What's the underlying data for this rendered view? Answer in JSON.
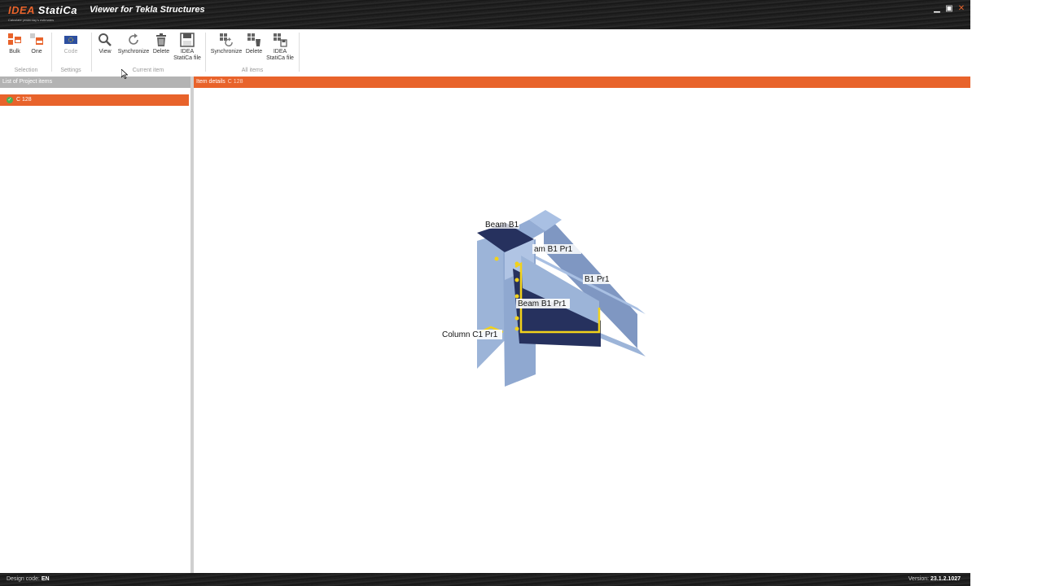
{
  "titlebar": {
    "logo_idea": "IDEA",
    "logo_statica": "StatiCa",
    "logo_tagline": "Calculate yesterday's estimates",
    "app_title": "Viewer for Tekla Structures",
    "minimize": "▁",
    "maximize": "▣",
    "close": "✕"
  },
  "ribbon": {
    "selection": {
      "bulk": "Bulk",
      "one": "One",
      "group": "Selection"
    },
    "settings": {
      "code": "Code",
      "group": "Settings"
    },
    "current_item": {
      "view": "View",
      "synchronize": "Synchronize",
      "delete": "Delete",
      "idea_file_1": "IDEA",
      "idea_file_2": "StatiCa file",
      "group": "Current item"
    },
    "all_items": {
      "synchronize": "Synchronize",
      "delete": "Delete",
      "idea_file_1": "IDEA",
      "idea_file_2": "StatiCa file",
      "group": "All items"
    }
  },
  "left_panel": {
    "header": "List of Project items",
    "items": [
      {
        "label": "C 128",
        "status": "ok"
      }
    ]
  },
  "right_panel": {
    "header": "Item details",
    "item_code": "C 128",
    "labels": {
      "beam_top": "Beam B1",
      "beam_1": "am B1 Pr1",
      "beam_2": "B1 Pr1",
      "beam_3": "Beam B1 Pr1",
      "column": "Column C1 Pr1"
    }
  },
  "statusbar": {
    "design_code_label": "Design code:",
    "design_code": "EN",
    "version_label": "Version:",
    "version": "23.1.2.1027"
  },
  "colors": {
    "accent": "#e8632b",
    "steel": "#9cb4d8",
    "steel_dark": "#26315e",
    "weld": "#f2d21b"
  }
}
